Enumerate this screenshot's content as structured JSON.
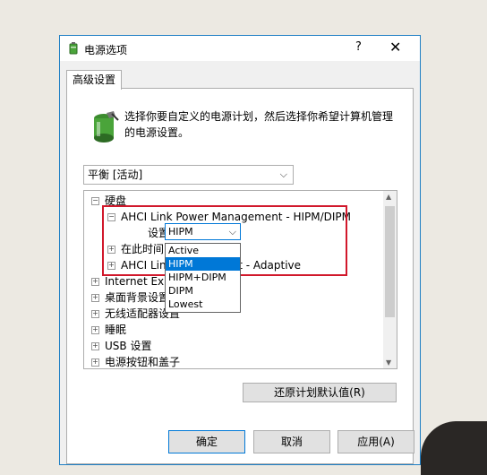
{
  "window": {
    "title": "电源选项",
    "help_glyph": "?",
    "close_glyph": "✕"
  },
  "tab": {
    "label": "高级设置"
  },
  "description": "选择你要自定义的电源计划，然后选择你希望计算机管理的电源设置。",
  "plan_select": {
    "value": "平衡 [活动]"
  },
  "tree": {
    "items": [
      {
        "label": "硬盘",
        "expander": "⊟"
      },
      {
        "label": "AHCI Link Power Management - HIPM/DIPM",
        "expander": "⊟"
      },
      {
        "label": "设置:"
      },
      {
        "label": "在此时间",
        "expander": "⊞"
      },
      {
        "label": "AHCI Lin",
        "suffix": "ment - Adaptive",
        "expander": "⊞"
      },
      {
        "label": "Internet Explo",
        "expander": "⊞"
      },
      {
        "label": "桌面背景设置",
        "expander": "⊞"
      },
      {
        "label": "无线适配器设置",
        "expander": "⊞"
      },
      {
        "label": "睡眠",
        "expander": "⊞"
      },
      {
        "label": "USB 设置",
        "expander": "⊞"
      },
      {
        "label": "电源按钮和盖子",
        "expander": "⊞"
      }
    ]
  },
  "combo": {
    "value": "HIPM"
  },
  "dropdown": {
    "options": [
      "Active",
      "HIPM",
      "HIPM+DIPM",
      "DIPM",
      "Lowest"
    ],
    "selected_index": 1
  },
  "buttons": {
    "restore": "还原计划默认值(R)",
    "ok": "确定",
    "cancel": "取消",
    "apply": "应用(A)"
  },
  "colors": {
    "accent": "#0078d7",
    "highlight": "#d1182b"
  }
}
